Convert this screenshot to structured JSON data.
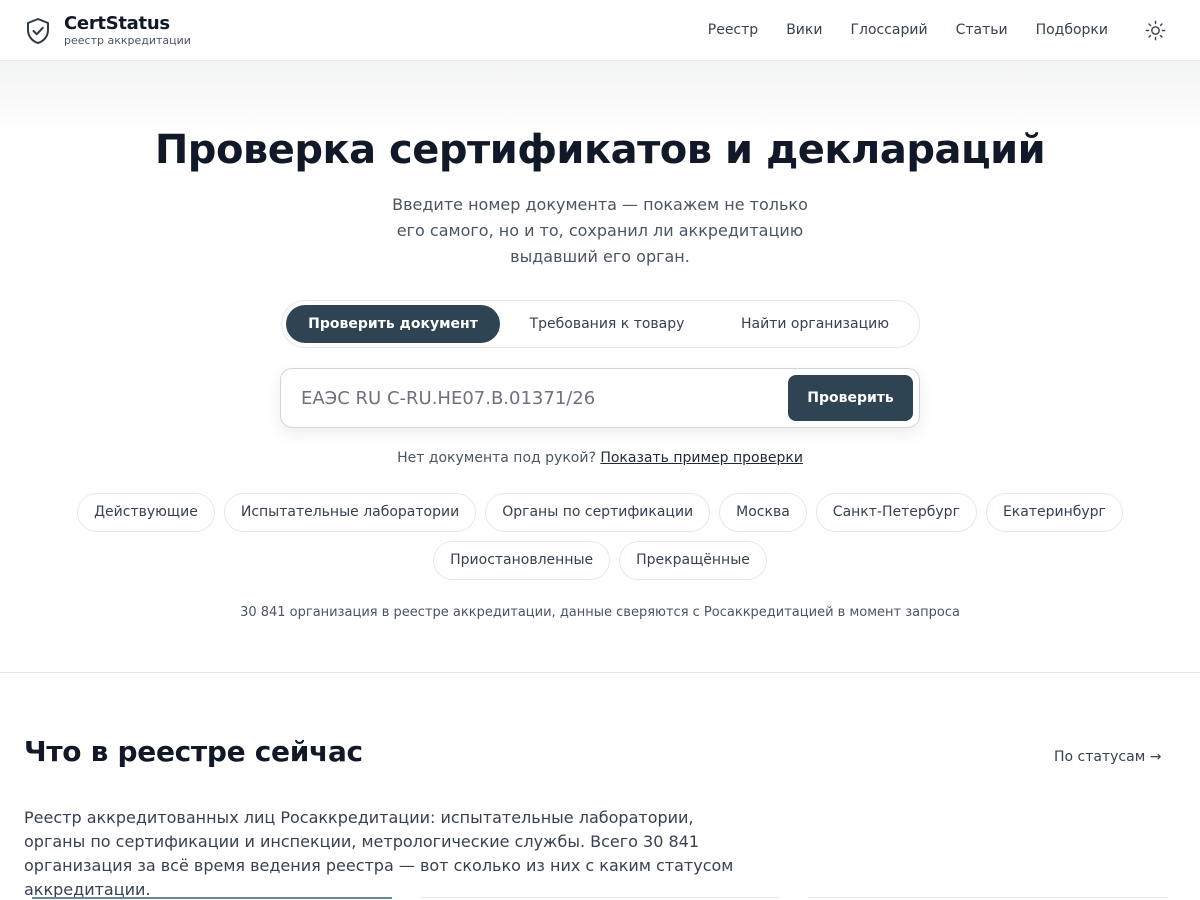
{
  "brand": {
    "name": "CertStatus",
    "subtitle": "реестр аккредитации",
    "logo_icon": "shield-check-icon"
  },
  "nav": {
    "items": [
      "Реестр",
      "Вики",
      "Глоссарий",
      "Статьи",
      "Подборки"
    ],
    "theme_icon": "sun-icon"
  },
  "hero": {
    "title": "Проверка сертификатов и деклараций",
    "subtitle": "Введите номер документа — покажем не только его самого, но и то, сохранил ли аккредитацию выдавший его орган.",
    "tabs": [
      {
        "label": "Проверить документ",
        "active": true
      },
      {
        "label": "Требования к товару",
        "active": false
      },
      {
        "label": "Найти организацию",
        "active": false
      }
    ],
    "search": {
      "placeholder": "ЕАЭС RU С-RU.НЕ07.В.01371/26",
      "value": "",
      "button_label": "Проверить"
    },
    "hint_text": "Нет документа под рукой?",
    "hint_link": "Показать пример проверки",
    "chips": [
      "Действующие",
      "Испытательные лаборатории",
      "Органы по сертификации",
      "Москва",
      "Санкт-Петербург",
      "Екатеринбург",
      "Приостановленные",
      "Прекращённые"
    ],
    "stats": "30 841 организация в реестре аккредитации, данные сверяются с Росаккредитацией в момент запроса"
  },
  "section": {
    "title": "Что в реестре сейчас",
    "link": "По статусам →",
    "description": "Реестр аккредитованных лиц Росаккредитации: испытательные лаборатории, органы по сертификации и инспекции, метрологические службы. Всего 30 841 организация за всё время ведения реестра — вот сколько из них с каким статусом аккредитации."
  },
  "colors": {
    "accent": "#2e4453",
    "text": "#111827",
    "muted": "#4b5563",
    "border": "#e5e7eb"
  }
}
